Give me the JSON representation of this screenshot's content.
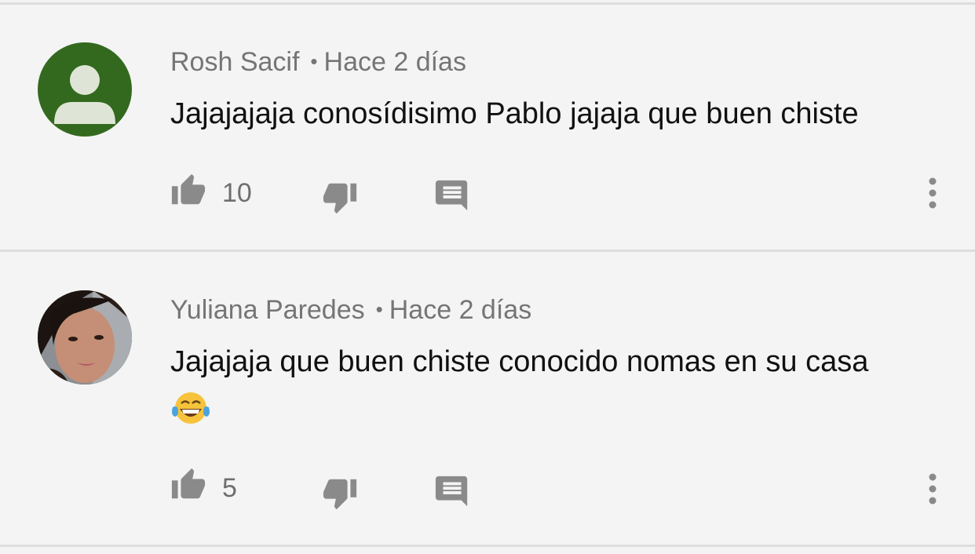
{
  "comments": [
    {
      "author": "Rosh Sacif",
      "separator": "•",
      "time": "Hace 2 días",
      "text": "Jajajajaja conosídisimo Pablo jajaja que buen chiste",
      "likes": "10",
      "avatar_type": "default-user",
      "avatar_color": "#33691e"
    },
    {
      "author": "Yuliana Paredes",
      "separator": "•",
      "time": "Hace 2 días",
      "text": "Jajajaja que buen chiste conocido nomas en su casa",
      "emoji": "tears-of-joy-emoji",
      "likes": "5",
      "avatar_type": "photo"
    }
  ],
  "icons": {
    "like": "thumb-up-icon",
    "dislike": "thumb-down-icon",
    "reply": "reply-icon",
    "more": "more-vert-icon"
  },
  "colors": {
    "background": "#f4f4f4",
    "icon": "#8a8a8a",
    "meta_text": "#757575",
    "body_text": "#111111"
  }
}
